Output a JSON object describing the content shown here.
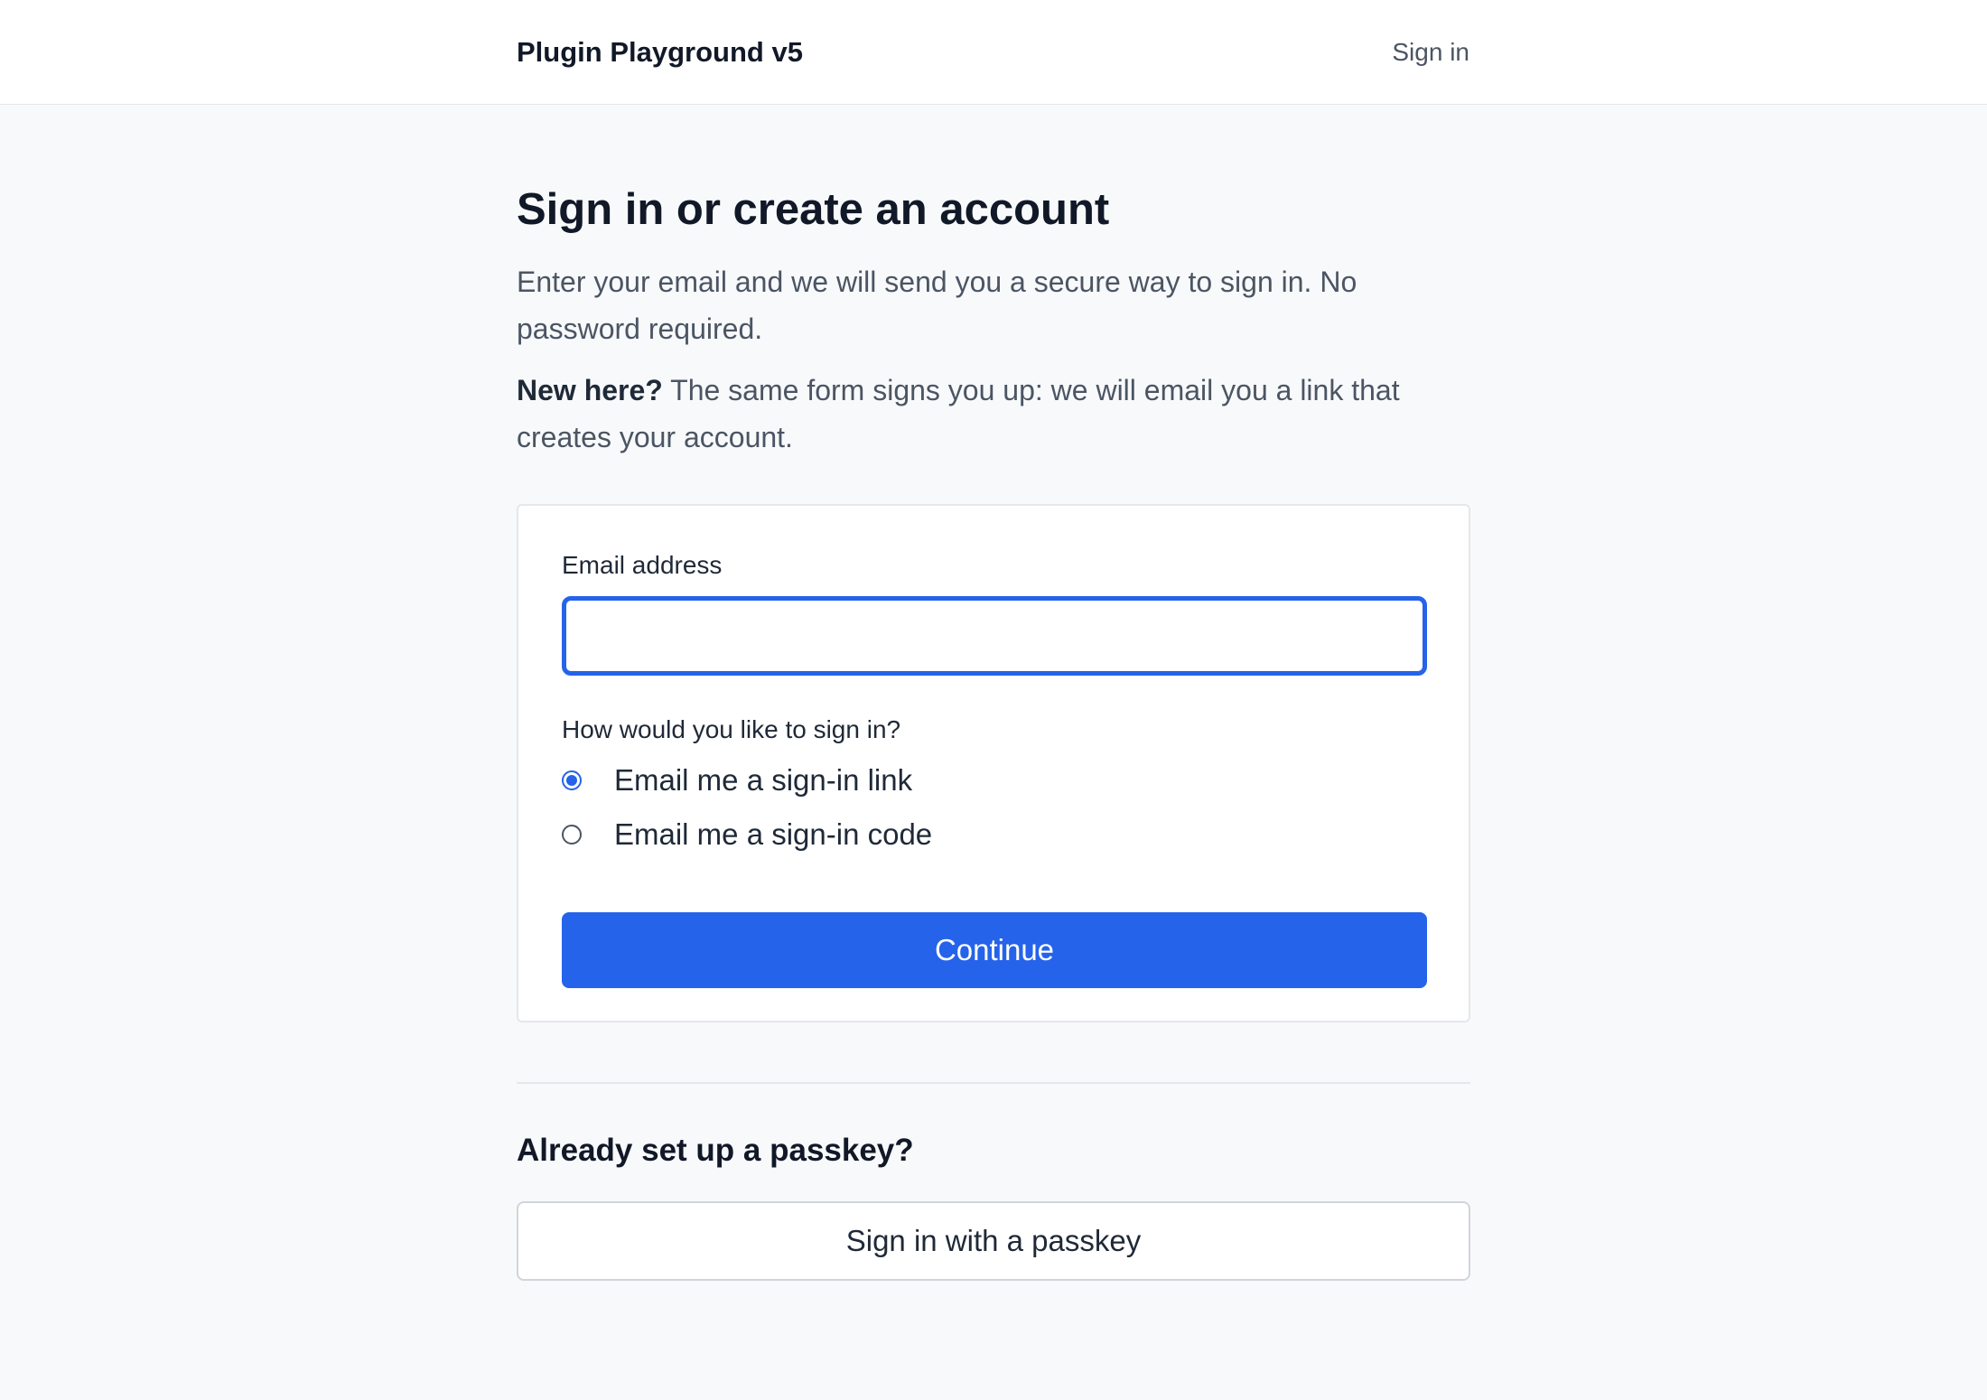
{
  "header": {
    "brand": "Plugin Playground v5",
    "sign_in_link": "Sign in"
  },
  "main": {
    "title": "Sign in or create an account",
    "intro": "Enter your email and we will send you a secure way to sign in. No password required.",
    "new_here_label": "New here?",
    "new_here_text": " The same form signs you up: we will email you a link that creates your account."
  },
  "form": {
    "email_label": "Email address",
    "email_value": "",
    "email_placeholder": "",
    "method_label": "How would you like to sign in?",
    "options": [
      {
        "label": "Email me a sign-in link",
        "selected": true
      },
      {
        "label": "Email me a sign-in code",
        "selected": false
      }
    ],
    "continue_label": "Continue"
  },
  "passkey": {
    "heading": "Already set up a passkey?",
    "button_label": "Sign in with a passkey"
  },
  "colors": {
    "accent": "#2563eb",
    "page_background": "#f8f9fb",
    "text_primary": "#111827",
    "text_secondary": "#4b5563",
    "border": "#e5e7eb"
  }
}
